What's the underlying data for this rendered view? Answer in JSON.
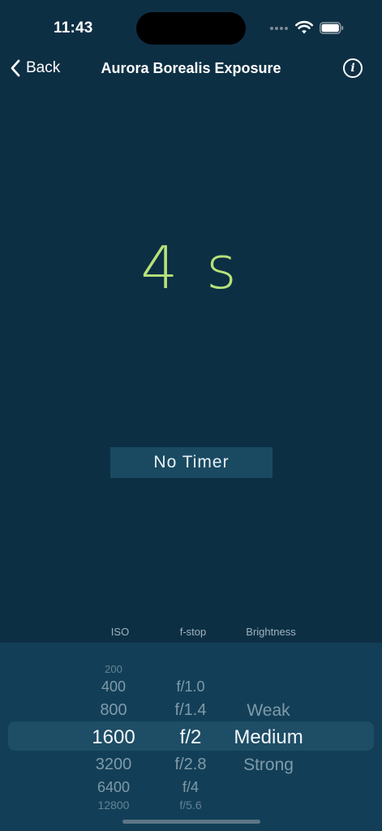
{
  "status_bar": {
    "time": "11:43"
  },
  "nav": {
    "back_label": "Back",
    "title": "Aurora Borealis Exposure"
  },
  "exposure": {
    "value": "4 s"
  },
  "timer": {
    "label": "No Timer"
  },
  "picker": {
    "headers": [
      "ISO",
      "f-stop",
      "Brightness"
    ],
    "iso": [
      "200",
      "400",
      "800",
      "1600",
      "3200",
      "6400",
      "12800"
    ],
    "fstop": [
      "f/1.0",
      "f/1.4",
      "f/2",
      "f/2.8",
      "f/4",
      "f/5.6"
    ],
    "brightness": [
      "Weak",
      "Medium",
      "Strong"
    ],
    "selected": {
      "iso": "1600",
      "fstop": "f/2",
      "brightness": "Medium"
    }
  },
  "colors": {
    "background": "#0d2f44",
    "picker_background": "#123f57",
    "accent": "#b7e27a",
    "button": "#1a4a62"
  }
}
